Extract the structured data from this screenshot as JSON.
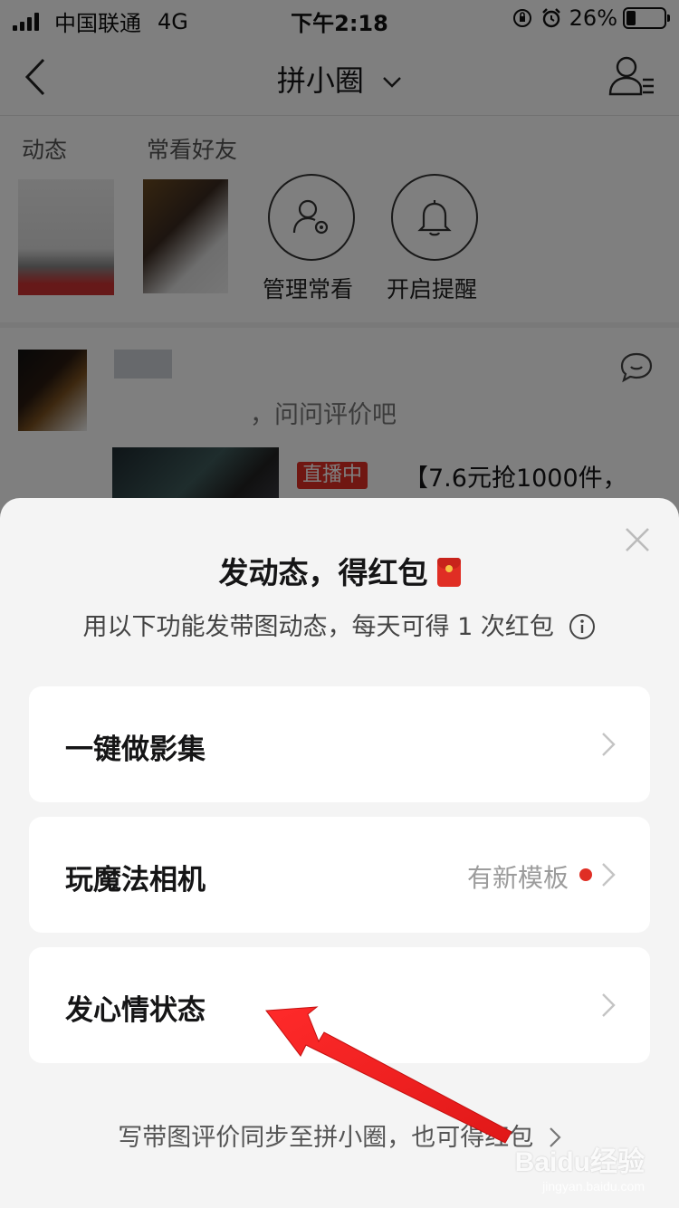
{
  "status_bar": {
    "carrier": "中国联通",
    "network": "4G",
    "time": "下午2:18",
    "battery": "26%",
    "battery_level": 0.26
  },
  "nav": {
    "title": "拼小圈",
    "icons": [
      "back-icon",
      "chevron-down-icon",
      "friends-list-icon"
    ]
  },
  "friends_section": {
    "tab_dynamic": "动态",
    "tab_frequent": "常看好友",
    "actions": [
      {
        "label": "管理常看",
        "icon": "manage-user-icon"
      },
      {
        "label": "开启提醒",
        "icon": "bell-icon"
      }
    ]
  },
  "post": {
    "question": "，问问评价吧",
    "live_badge": "直播中",
    "product_title": "【7.6元抢1000件，"
  },
  "sheet": {
    "title": "发动态，得红包",
    "subtitle": "用以下功能发带图动态，每天可得 1 次红包",
    "options": [
      {
        "label": "一键做影集",
        "hint": ""
      },
      {
        "label": "玩魔法相机",
        "hint": "有新模板"
      },
      {
        "label": "发心情状态",
        "hint": ""
      }
    ],
    "footer_link": "写带图评价同步至拼小圈，也可得红包"
  },
  "watermark": {
    "brand": "Baidu经验",
    "url": "jingyan.baidu.com"
  },
  "colors": {
    "accent_red": "#e02e24",
    "annotation_arrow": "#f02a2a",
    "overlay": "rgba(0,0,0,0.5)",
    "sheet_bg": "#f4f4f4"
  }
}
